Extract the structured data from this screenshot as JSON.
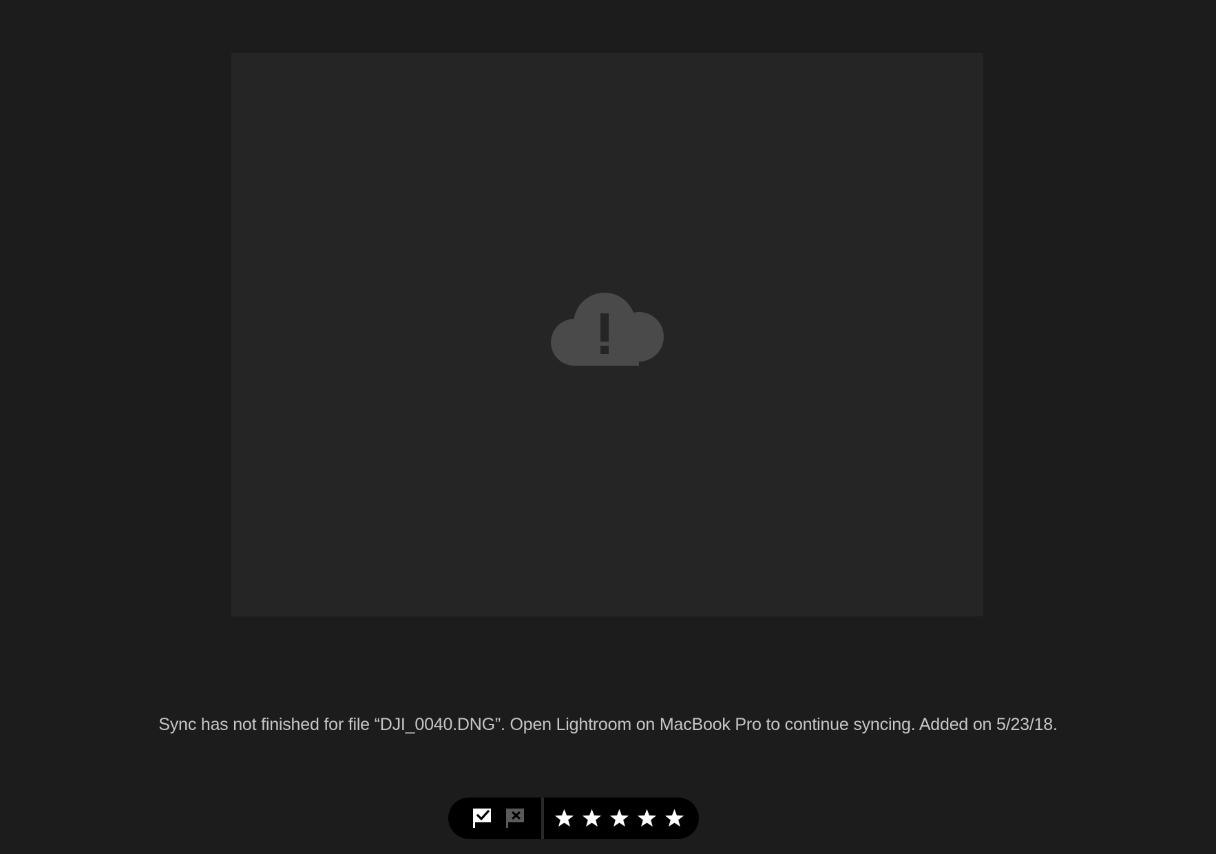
{
  "viewer": {
    "status_icon": "cloud-alert-icon",
    "message": "Sync has not finished for file “DJI_0040.DNG”. Open Lightroom on MacBook Pro to continue syncing. Added on 5/23/18."
  },
  "rating_bar": {
    "flags": [
      {
        "name": "pick",
        "icon": "flag-pick-icon"
      },
      {
        "name": "reject",
        "icon": "flag-reject-icon"
      }
    ],
    "star_icon": "star-icon",
    "star_count": 5,
    "rating": 0
  },
  "colors": {
    "background": "#1c1c1c",
    "placeholder": "#252525",
    "icon_gray": "#4a4a4a",
    "text": "#c6c6c6",
    "toolbar": "#000000",
    "toolbar_icon": "#ffffff",
    "reject_icon": "#5a5a5a"
  }
}
